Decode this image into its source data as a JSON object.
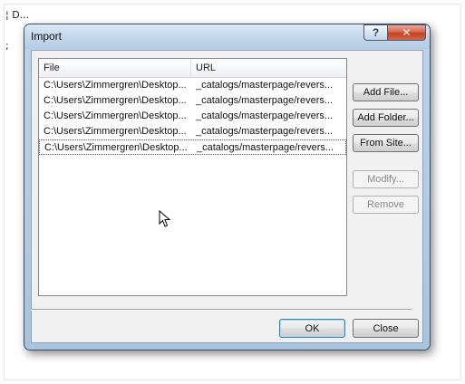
{
  "background": {
    "text_top": "¦ D...",
    "text_mid": ";"
  },
  "window": {
    "title": "Import",
    "help_glyph": "?",
    "close_glyph": "✕"
  },
  "list": {
    "columns": [
      "File",
      "URL"
    ],
    "rows": [
      {
        "file": "C:\\Users\\Zimmergren\\Desktop...",
        "url": "_catalogs/masterpage/revers..."
      },
      {
        "file": "C:\\Users\\Zimmergren\\Desktop...",
        "url": "_catalogs/masterpage/revers..."
      },
      {
        "file": "C:\\Users\\Zimmergren\\Desktop...",
        "url": "_catalogs/masterpage/revers..."
      },
      {
        "file": "C:\\Users\\Zimmergren\\Desktop...",
        "url": "_catalogs/masterpage/revers..."
      },
      {
        "file": "C:\\Users\\Zimmergren\\Desktop...",
        "url": "_catalogs/masterpage/revers..."
      }
    ],
    "focused_row": 4
  },
  "buttons": {
    "add_file": "Add File...",
    "add_folder": "Add Folder...",
    "from_site": "From Site...",
    "modify": "Modify...",
    "remove": "Remove",
    "ok": "OK",
    "close": "Close"
  },
  "colors": {
    "window_frame": "#a9c4de",
    "close_button": "#c3401f",
    "default_button_border": "#3c7fb1"
  }
}
